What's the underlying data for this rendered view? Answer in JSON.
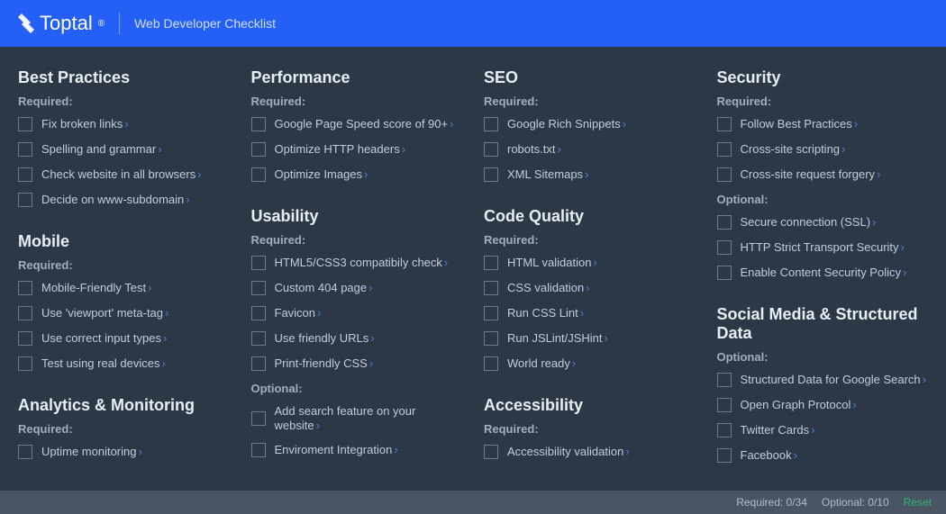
{
  "header": {
    "brand": "Toptal",
    "title": "Web Developer Checklist"
  },
  "columns": [
    {
      "sections": [
        {
          "title": "Best Practices",
          "groups": [
            {
              "label": "Required:",
              "items": [
                "Fix broken links",
                "Spelling and grammar",
                "Check website in all browsers",
                "Decide on www-subdomain"
              ]
            }
          ]
        },
        {
          "title": "Mobile",
          "groups": [
            {
              "label": "Required:",
              "items": [
                "Mobile-Friendly Test",
                "Use 'viewport' meta-tag",
                "Use correct input types",
                "Test using real devices"
              ]
            }
          ]
        },
        {
          "title": "Analytics & Monitoring",
          "groups": [
            {
              "label": "Required:",
              "items": [
                "Uptime monitoring"
              ]
            }
          ]
        }
      ]
    },
    {
      "sections": [
        {
          "title": "Performance",
          "groups": [
            {
              "label": "Required:",
              "items": [
                "Google Page Speed score of 90+",
                "Optimize HTTP headers",
                "Optimize Images"
              ]
            }
          ]
        },
        {
          "title": "Usability",
          "groups": [
            {
              "label": "Required:",
              "items": [
                "HTML5/CSS3 compatibily check",
                "Custom 404 page",
                "Favicon",
                "Use friendly URLs",
                "Print-friendly CSS"
              ]
            },
            {
              "label": "Optional:",
              "items": [
                "Add search feature on your website",
                "Enviroment Integration"
              ]
            }
          ]
        }
      ]
    },
    {
      "sections": [
        {
          "title": "SEO",
          "groups": [
            {
              "label": "Required:",
              "items": [
                "Google Rich Snippets",
                "robots.txt",
                "XML Sitemaps"
              ]
            }
          ]
        },
        {
          "title": "Code Quality",
          "groups": [
            {
              "label": "Required:",
              "items": [
                "HTML validation",
                "CSS validation",
                "Run CSS Lint",
                "Run JSLint/JSHint",
                "World ready"
              ]
            }
          ]
        },
        {
          "title": "Accessibility",
          "groups": [
            {
              "label": "Required:",
              "items": [
                "Accessibility validation"
              ]
            }
          ]
        }
      ]
    },
    {
      "sections": [
        {
          "title": "Security",
          "groups": [
            {
              "label": "Required:",
              "items": [
                "Follow Best Practices",
                "Cross-site scripting",
                "Cross-site request forgery"
              ]
            },
            {
              "label": "Optional:",
              "items": [
                "Secure connection (SSL)",
                "HTTP Strict Transport Security",
                "Enable Content Security Policy"
              ]
            }
          ]
        },
        {
          "title": "Social Media & Structured Data",
          "groups": [
            {
              "label": "Optional:",
              "items": [
                "Structured Data for Google Search",
                "Open Graph Protocol",
                "Twitter Cards",
                "Facebook"
              ]
            }
          ]
        }
      ]
    }
  ],
  "footer": {
    "required": "Required: 0/34",
    "optional": "Optional: 0/10",
    "reset": "Reset"
  }
}
